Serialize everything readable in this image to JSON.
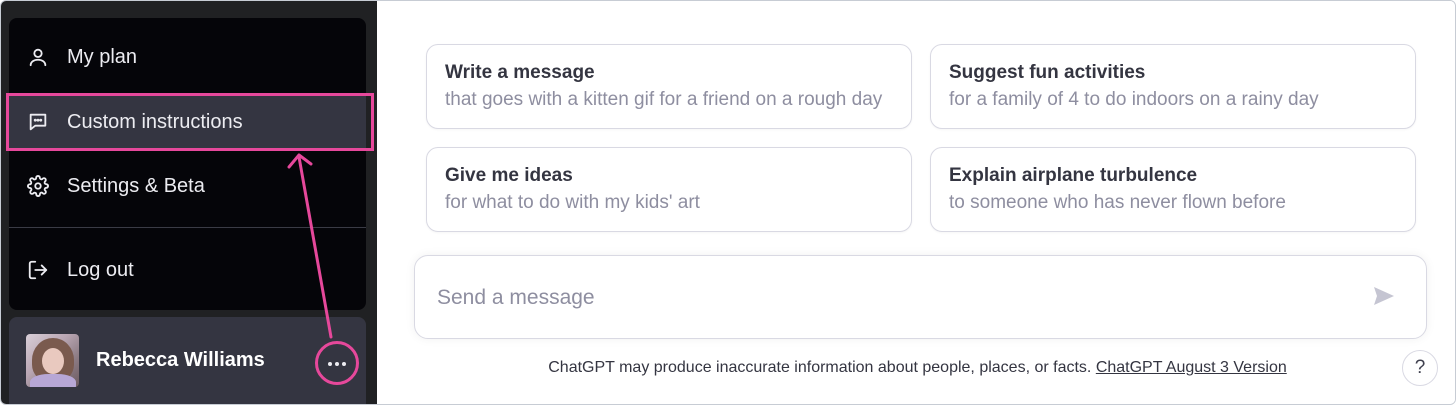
{
  "sidebar": {
    "menu": [
      {
        "label": "My plan",
        "icon": "user-icon"
      },
      {
        "label": "Custom instructions",
        "icon": "chat-bubble-icon"
      },
      {
        "label": "Settings & Beta",
        "icon": "gear-icon"
      },
      {
        "label": "Log out",
        "icon": "logout-icon"
      }
    ],
    "user": {
      "name": "Rebecca Williams",
      "more_icon": "ellipsis-icon"
    },
    "highlight_color": "#e6489b"
  },
  "main": {
    "suggestions": [
      {
        "title": "Write a message",
        "subtitle": "that goes with a kitten gif for a friend on a rough day"
      },
      {
        "title": "Suggest fun activities",
        "subtitle": "for a family of 4 to do indoors on a rainy day"
      },
      {
        "title": "Give me ideas",
        "subtitle": "for what to do with my kids' art"
      },
      {
        "title": "Explain airplane turbulence",
        "subtitle": "to someone who has never flown before"
      }
    ],
    "composer": {
      "placeholder": "Send a message",
      "send_icon": "send-icon"
    },
    "disclaimer": {
      "text": "ChatGPT may produce inaccurate information about people, places, or facts. ",
      "link": "ChatGPT August 3 Version"
    },
    "help_label": "?"
  }
}
